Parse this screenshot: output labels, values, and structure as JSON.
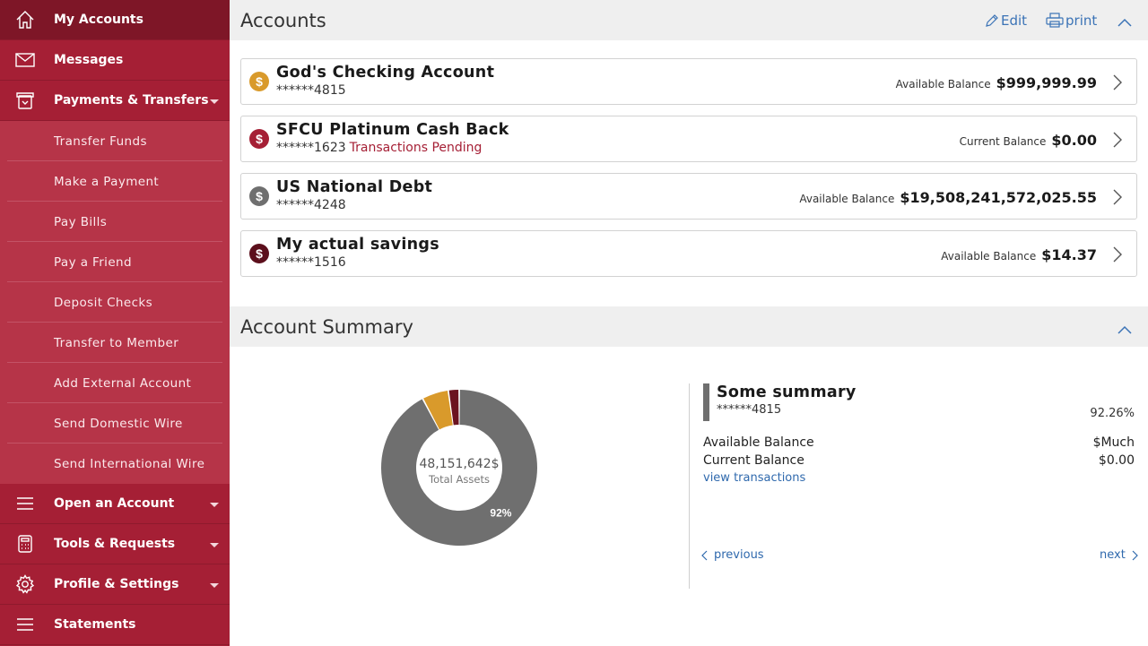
{
  "sidebar": {
    "top_items": [
      {
        "label": "My Accounts"
      },
      {
        "label": "Messages"
      },
      {
        "label": "Payments & Transfers"
      }
    ],
    "sub_items": [
      {
        "label": "Transfer Funds"
      },
      {
        "label": "Make a Payment"
      },
      {
        "label": "Pay Bills"
      },
      {
        "label": "Pay a Friend"
      },
      {
        "label": "Deposit Checks"
      },
      {
        "label": "Transfer to Member"
      },
      {
        "label": "Add External Account"
      },
      {
        "label": "Send Domestic Wire"
      },
      {
        "label": "Send International Wire"
      }
    ],
    "bottom_items": [
      {
        "label": "Open an Account"
      },
      {
        "label": "Tools & Requests"
      },
      {
        "label": "Profile & Settings"
      },
      {
        "label": "Statements"
      }
    ]
  },
  "accounts_section": {
    "title": "Accounts",
    "edit_label": "Edit",
    "print_label": "print"
  },
  "accounts": [
    {
      "name": "God's Checking Account",
      "number": "******4815",
      "pending": "",
      "balance_label": "Available Balance",
      "balance": "$999,999.99",
      "icon_color": "#d99a2b"
    },
    {
      "name": "SFCU Platinum Cash Back",
      "number": "******1623",
      "pending": "Transactions Pending",
      "balance_label": "Current Balance",
      "balance": "$0.00",
      "icon_color": "#a51f35"
    },
    {
      "name": "US National Debt",
      "number": "******4248",
      "pending": "",
      "balance_label": "Available Balance",
      "balance": "$19,508,241,572,025.55",
      "icon_color": "#6f6f6f"
    },
    {
      "name": "My actual savings",
      "number": "******1516",
      "pending": "",
      "balance_label": "Available Balance",
      "balance": "$14.37",
      "icon_color": "#5c0f1c"
    }
  ],
  "summary_section": {
    "title": "Account Summary",
    "total_assets_value": "48,151,642$",
    "total_assets_label": "Total Assets",
    "detail": {
      "title": "Some summary",
      "number": "******4815",
      "percent": "92.26%",
      "available_label": "Available Balance",
      "available_value": "$Much",
      "current_label": "Current Balance",
      "current_value": "$0.00",
      "view_link": "view transactions"
    },
    "previous_label": "previous",
    "next_label": "next"
  },
  "chart_data": {
    "type": "pie",
    "segments": [
      {
        "value": 92.26,
        "color": "#6f6f6f",
        "label": "92%"
      },
      {
        "value": 5.5,
        "color": "#d99a2b",
        "label": ""
      },
      {
        "value": 2.24,
        "color": "#6b1320",
        "label": ""
      }
    ]
  }
}
